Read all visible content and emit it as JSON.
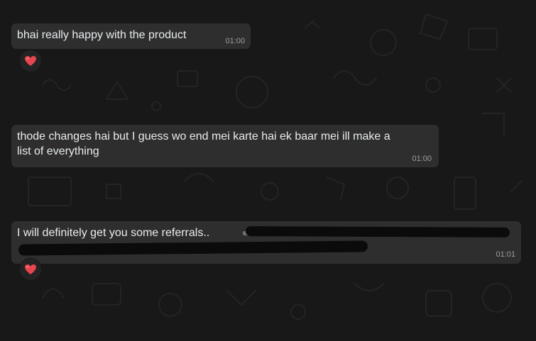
{
  "messages": [
    {
      "text": "bhai really happy with the product",
      "time": "01:00",
      "reaction": "heart-emoji"
    },
    {
      "text_line1": "thode changes hai but I guess wo end mei karte hai ek baar mei ill make a",
      "text_line2": "list of everything",
      "time": "01:00"
    },
    {
      "text": "I will definitely get you some referrals..",
      "time": "01:01",
      "reaction": "heart-emoji",
      "redacted": true
    }
  ],
  "colors": {
    "background": "#181818",
    "bubble": "#2e2e2e",
    "text": "#e9edef",
    "timestamp": "#9aa0a4",
    "heart": "#e8454f"
  }
}
